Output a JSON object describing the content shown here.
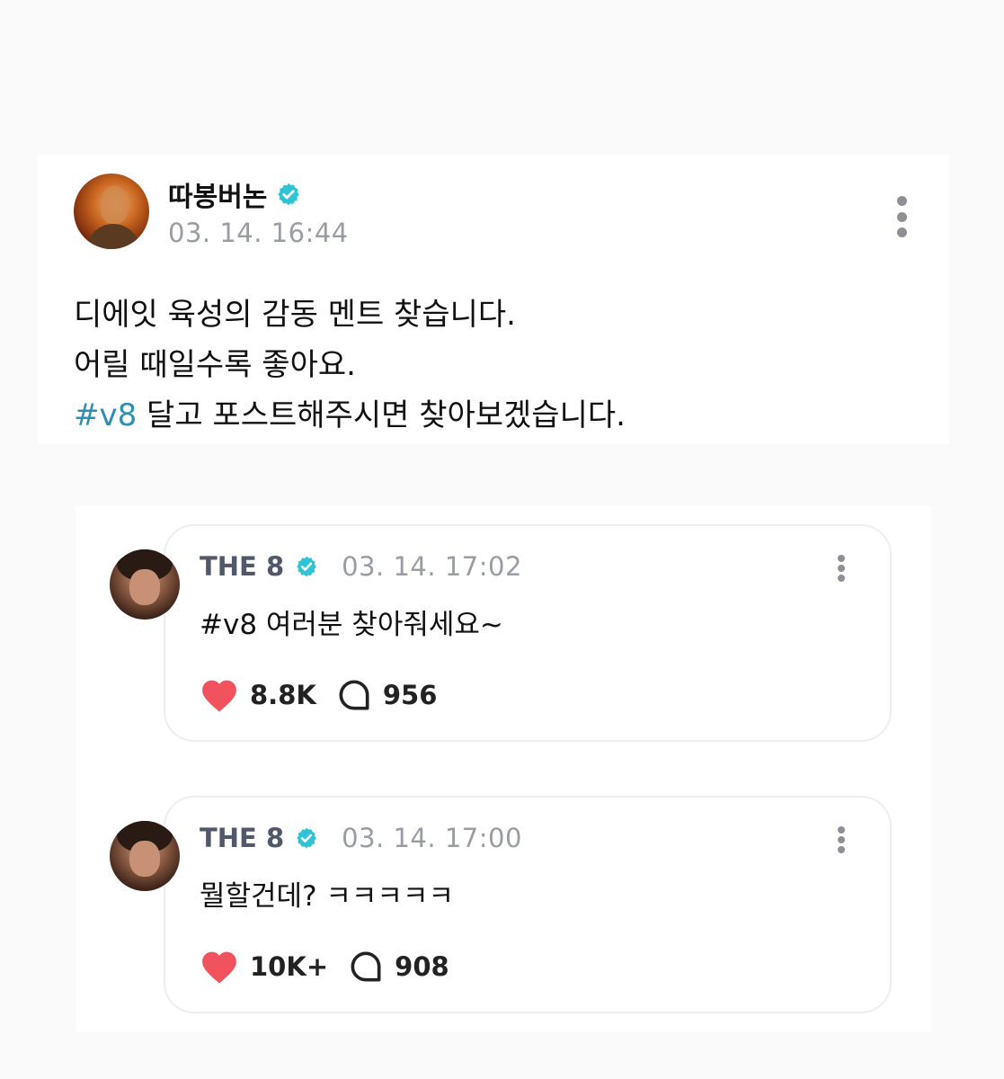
{
  "post": {
    "author": "따봉버논",
    "timestamp": "03. 14. 16:44",
    "body_line1": "디에잇 육성의 감동 멘트 찾습니다.",
    "body_line2": "어릴 때일수록 좋아요.",
    "body_line3_hashtag": "#v8",
    "body_line3_rest": " 달고 포스트해주시면 찾아보겠습니다."
  },
  "replies": [
    {
      "author": "THE 8",
      "timestamp": "03. 14. 17:02",
      "text": "#v8 여러분 찾아줘세요~",
      "likes": "8.8K",
      "comments": "956"
    },
    {
      "author": "THE 8",
      "timestamp": "03. 14. 17:00",
      "text": "뭘할건데? ㅋㅋㅋㅋㅋ",
      "likes": "10K+",
      "comments": "908"
    }
  ],
  "icons": {
    "verified": "verified-badge-icon",
    "like": "heart-icon",
    "comment": "speech-bubble-icon",
    "menu": "more-vertical-icon"
  },
  "colors": {
    "verified": "#2ec4d6",
    "heart": "#f0525e",
    "hashtag": "#2f8fb0",
    "timestamp": "#9a9ca3"
  }
}
